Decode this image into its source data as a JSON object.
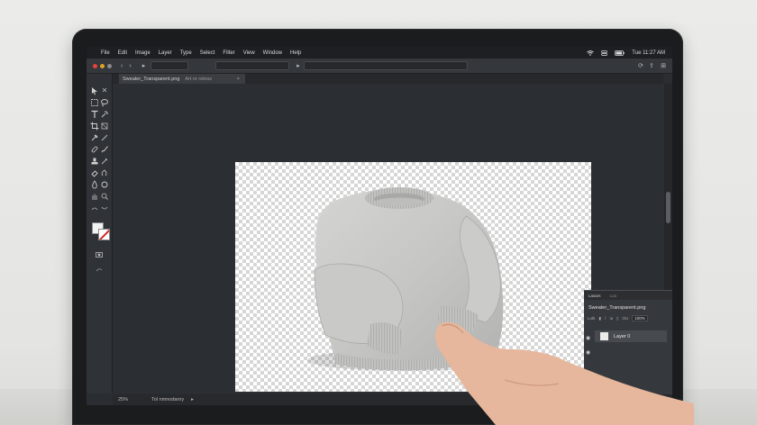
{
  "menubar": {
    "apple_glyph": "",
    "items": [
      "File",
      "Edit",
      "Image",
      "Layer",
      "Type",
      "Select",
      "Filter",
      "View",
      "Window",
      "Help"
    ],
    "clock": "Tue 11:27 AM"
  },
  "document": {
    "tab_title": "Sweater_Transparent.png",
    "tab_subtitle": "Art re reless",
    "close_glyph": "×"
  },
  "status": {
    "zoom": "25%",
    "info": "Tol nmnodanry"
  },
  "layers_panel": {
    "tabs": [
      "Lasars",
      "Loa"
    ],
    "file_name": "Sweater_Transparent.png",
    "lock_label": "Lotk",
    "opacity_label": "OU",
    "opacity_value": "100%",
    "layer_name": "Layer 0"
  },
  "colors": {
    "screen_bg": "#2a2d31",
    "menubar_bg": "#1e1f22",
    "canvas_checker": "#d6d6d6",
    "bg_swatch_slash": "#d02525"
  },
  "icons": [
    "apple-icon",
    "wifi-icon",
    "control-center-icon",
    "battery-icon",
    "move-tool-icon",
    "marquee-tool-icon",
    "lasso-tool-icon",
    "crop-tool-icon",
    "type-tool-icon",
    "brush-tool-icon",
    "eraser-tool-icon",
    "eye-icon"
  ]
}
